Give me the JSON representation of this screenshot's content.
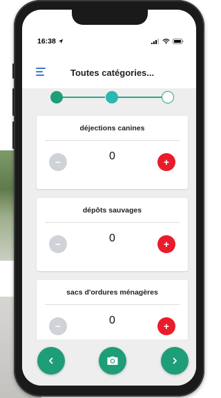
{
  "status_bar": {
    "time": "16:38",
    "location_icon": "location-arrow-icon",
    "signal_icon": "signal-icon",
    "wifi_icon": "wifi-icon",
    "battery_icon": "battery-icon"
  },
  "header": {
    "title": "Toutes catégories...",
    "menu_icon": "menu-icon"
  },
  "stepper": {
    "steps": [
      "done",
      "current",
      "todo"
    ],
    "current_step": 2,
    "total_steps": 3
  },
  "categories": [
    {
      "label": "déjections canines",
      "count": "0",
      "minus_label": "−",
      "plus_label": "+"
    },
    {
      "label": "dépôts sauvages",
      "count": "0",
      "minus_label": "−",
      "plus_label": "+"
    },
    {
      "label": "sacs d'ordures ménagères",
      "count": "0",
      "minus_label": "−",
      "plus_label": "+"
    }
  ],
  "bottom_bar": {
    "prev_icon": "chevron-left-icon",
    "camera_icon": "camera-icon",
    "next_icon": "chevron-right-icon"
  },
  "colors": {
    "accent_green": "#1e9e78",
    "accent_teal": "#2ab8b0",
    "plus_red": "#ea1c2b",
    "minus_grey": "#cfd3d8",
    "menu_blue": "#3a7bd5"
  }
}
